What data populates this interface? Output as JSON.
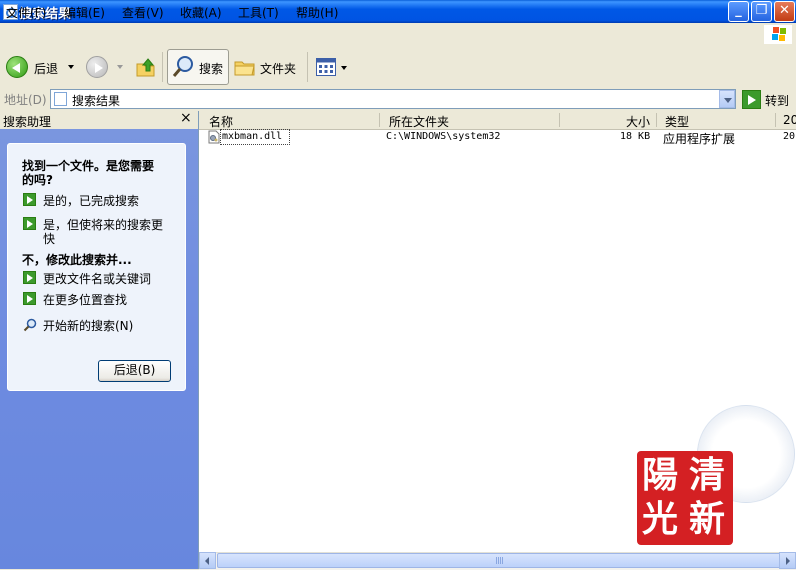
{
  "window": {
    "title": "搜索结果"
  },
  "menu": [
    "文件(F)",
    "编辑(E)",
    "查看(V)",
    "收藏(A)",
    "工具(T)",
    "帮助(H)"
  ],
  "toolbar": {
    "back": "后退",
    "search": "搜索",
    "folders": "文件夹"
  },
  "address": {
    "label": "地址(D)",
    "value": "搜索结果",
    "go": "转到"
  },
  "assistant": {
    "title": "搜索助理",
    "close": "×",
    "q1_line1": "找到一个文件。是您需要",
    "q1_line2": "的吗?",
    "opt1": "是的，已完成搜索",
    "opt2_line1": "是，但使将来的搜索更",
    "opt2_line2": "快",
    "q2": "不，修改此搜索并...",
    "opt3": "更改文件名或关键词",
    "opt4": "在更多位置查找",
    "opt5": "开始新的搜索(N)",
    "back_button": "后退(B)"
  },
  "columns": {
    "name": "名称",
    "folder": "所在文件夹",
    "size": "大小",
    "type": "类型",
    "date": "20"
  },
  "rows": [
    {
      "name": "mxbman.dll",
      "folder": "C:\\WINDOWS\\system32",
      "size": "18 KB",
      "type": "应用程序扩展",
      "date": "20"
    }
  ],
  "watermark": [
    "陽",
    "清",
    "光",
    "新"
  ],
  "colors": {
    "titlebar": "#0054E3",
    "pane": "#6E8BE0",
    "watermark": "#D42023"
  },
  "icons": [
    "back-arrow-icon",
    "forward-arrow-icon",
    "up-folder-icon",
    "search-magnifier-icon",
    "folder-icon",
    "views-icon",
    "go-arrow-icon",
    "green-arrow-icon",
    "dll-file-icon"
  ]
}
